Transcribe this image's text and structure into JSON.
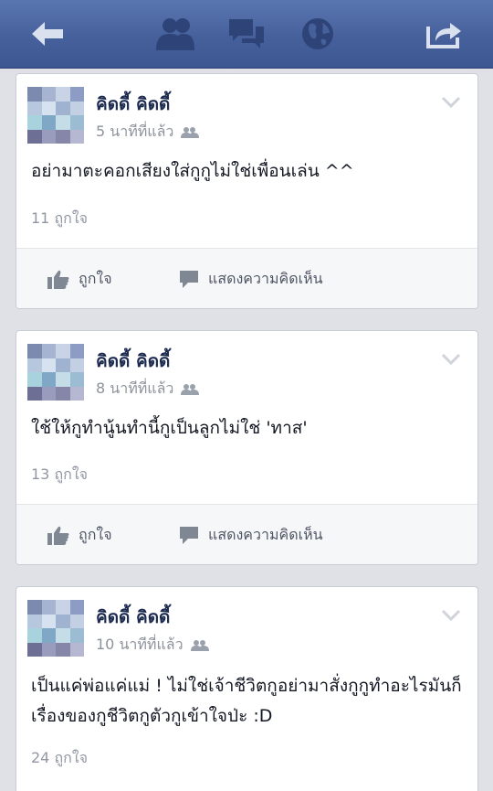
{
  "topbar": {
    "icons": [
      "back-arrow-icon",
      "friends-icon",
      "messages-icon",
      "globe-icon",
      "share-icon"
    ]
  },
  "posts": [
    {
      "author": "คิดดี้ คิดดี้",
      "time": "5 นาทีที่แล้ว",
      "lines": [
        "อย่ามาตะคอกเสียงใส่กูกูไม่ใช่เพื่อนเล่น ^^"
      ],
      "likes": "11 ถูกใจ",
      "like_label": "ถูกใจ",
      "comment_label": "แสดงความคิดเห็น"
    },
    {
      "author": "คิดดี้ คิดดี้",
      "time": "8 นาทีที่แล้ว",
      "lines": [
        "ใช้ให้กูทำนู้นทำนี้กูเป็นลูกไม่ใช่ 'ทาส'"
      ],
      "likes": "13 ถูกใจ",
      "like_label": "ถูกใจ",
      "comment_label": "แสดงความคิดเห็น"
    },
    {
      "author": "คิดดี้ คิดดี้",
      "time": "10 นาทีที่แล้ว",
      "lines": [
        "เป็นแค่พ่อแค่แม่ ! ไม่ใช่เจ้าชีวิตกูอย่ามาสั่งกูกูทำอะไรมันก็",
        "เรื่องของกูชีวิตกูตัวกูเข้าใจป่ะ :D"
      ],
      "likes": "24 ถูกใจ"
    }
  ],
  "colors": {
    "topbar": "#46609c",
    "author": "#1c2b4f",
    "meta": "#8d939c",
    "background": "#dfe1e6"
  }
}
